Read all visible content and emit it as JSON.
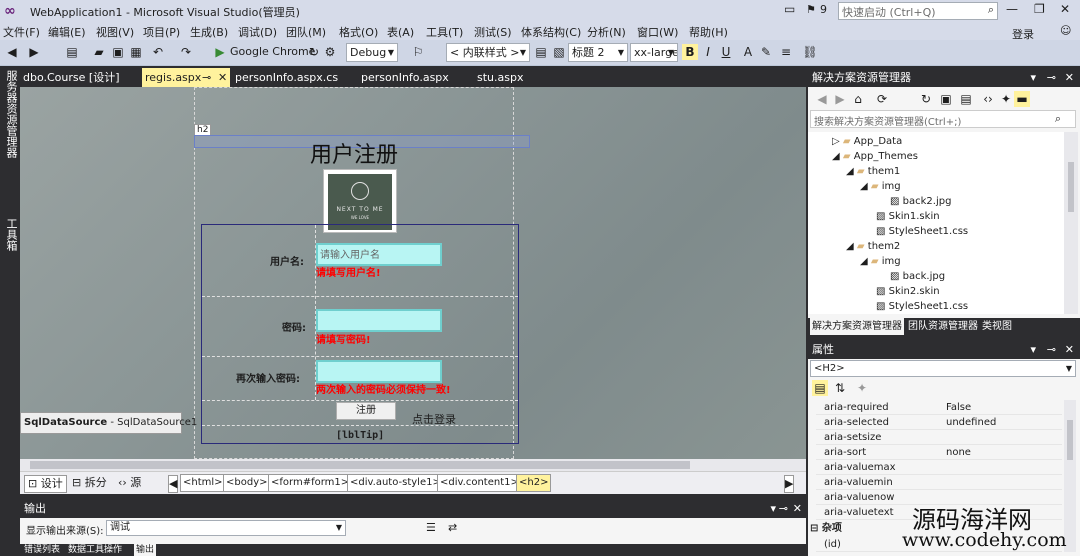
{
  "titlebar": {
    "title": "WebApplication1 - Microsoft Visual Studio(管理员)",
    "notification_count": "9",
    "quick_launch_placeholder": "快速启动 (Ctrl+Q)"
  },
  "menu": {
    "items": [
      "文件(F)",
      "编辑(E)",
      "视图(V)",
      "项目(P)",
      "生成(B)",
      "调试(D)",
      "团队(M)",
      "格式(O)",
      "表(A)",
      "工具(T)",
      "测试(S)",
      "体系结构(C)",
      "分析(N)",
      "窗口(W)",
      "帮助(H)"
    ],
    "login": "登录"
  },
  "toolbar": {
    "browser": "Google Chrome",
    "config": "Debug",
    "style_mode": "< 内联样式 >",
    "block_format": "标题 2",
    "font_size": "xx-large",
    "bold": "B",
    "italic": "I",
    "underline": "U"
  },
  "leftstrip": {
    "items": [
      "服务器资源管理器",
      "工具箱"
    ]
  },
  "doctabs": {
    "tabs": [
      "dbo.Course [设计]",
      "regis.aspx",
      "personInfo.aspx.cs",
      "personInfo.aspx",
      "stu.aspx"
    ]
  },
  "designer": {
    "h2_tag": "h2",
    "heading": "用户注册",
    "logo_text_1": "NEXT TO ME",
    "logo_text_2": "WE LOVE",
    "username_label": "用户名:",
    "username_placeholder": "请输入用户名",
    "username_error": "请填写用户名!",
    "password_label": "密码:",
    "password_error": "请填写密码!",
    "confirm_label": "再次输入密码:",
    "confirm_error": "两次输入的密码必须保持一致!",
    "register_button": "注册",
    "login_link": "点击登录",
    "tip_label": "[lblTip]",
    "datasource_bold": "SqlDataSource",
    "datasource_name": " - SqlDataSource1"
  },
  "viewbar": {
    "design": "设计",
    "split": "拆分",
    "source": "源",
    "breadcrumbs": [
      "<html>",
      "<body>",
      "<form#form1>",
      "<div.auto-style1>",
      "<div.content1>",
      "<h2>"
    ]
  },
  "output": {
    "title": "输出",
    "source_label": "显示输出来源(S):",
    "source_value": "调试",
    "bottom_tabs": [
      "错误列表",
      "数据工具操作",
      "输出"
    ]
  },
  "solution": {
    "title": "解决方案资源管理器",
    "search_placeholder": "搜索解决方案资源管理器(Ctrl+;)",
    "tree": [
      {
        "label": "App_Data",
        "indent": 0
      },
      {
        "label": "App_Themes",
        "indent": 0
      },
      {
        "label": "them1",
        "indent": 1
      },
      {
        "label": "img",
        "indent": 2
      },
      {
        "label": "back2.jpg",
        "indent": 3
      },
      {
        "label": "Skin1.skin",
        "indent": 2
      },
      {
        "label": "StyleSheet1.css",
        "indent": 2
      },
      {
        "label": "them2",
        "indent": 1
      },
      {
        "label": "img",
        "indent": 2
      },
      {
        "label": "back.jpg",
        "indent": 3
      },
      {
        "label": "Skin2.skin",
        "indent": 2
      },
      {
        "label": "StyleSheet1.css",
        "indent": 2
      }
    ],
    "tabs": [
      "解决方案资源管理器",
      "团队资源管理器",
      "类视图"
    ]
  },
  "properties": {
    "title": "属性",
    "object": "<H2>",
    "rows": [
      {
        "name": "aria-required",
        "value": "False"
      },
      {
        "name": "aria-selected",
        "value": "undefined"
      },
      {
        "name": "aria-setsize",
        "value": ""
      },
      {
        "name": "aria-sort",
        "value": "none"
      },
      {
        "name": "aria-valuemax",
        "value": ""
      },
      {
        "name": "aria-valuemin",
        "value": ""
      },
      {
        "name": "aria-valuenow",
        "value": ""
      },
      {
        "name": "aria-valuetext",
        "value": ""
      }
    ],
    "category": "杂项",
    "id_row": "(id)"
  },
  "watermark": {
    "line1": "源码海洋网",
    "line2": "www.codehy.com"
  }
}
